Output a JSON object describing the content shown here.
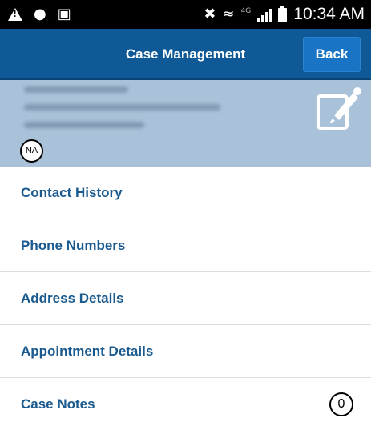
{
  "status_bar": {
    "time": "10:34 AM",
    "network": "4G",
    "icons": [
      "alert-icon",
      "app-icon",
      "camera-icon",
      "mute-icon",
      "wifi-icon",
      "signal-icon",
      "battery-icon"
    ]
  },
  "header": {
    "title": "Case Management",
    "back_label": "Back"
  },
  "case": {
    "status_badge": "NA",
    "edit_icon": "edit-icon"
  },
  "menu": {
    "items": [
      {
        "label": "Contact History"
      },
      {
        "label": "Phone Numbers"
      },
      {
        "label": "Address Details"
      },
      {
        "label": "Appointment Details"
      },
      {
        "label": "Case Notes",
        "count": "0"
      }
    ]
  },
  "colors": {
    "header_bg": "#0f5a96",
    "back_button_bg": "#1974c6",
    "case_panel_bg": "#a9c2d9",
    "menu_text": "#1a5a8f"
  }
}
